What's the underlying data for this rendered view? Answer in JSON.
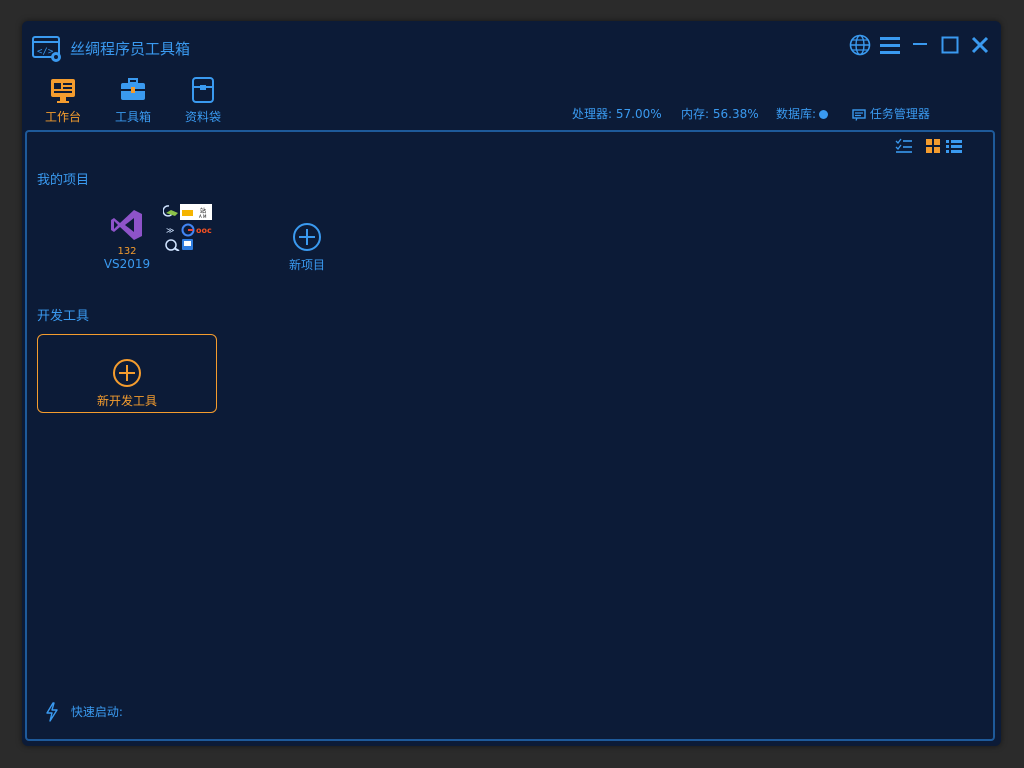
{
  "app": {
    "title": "丝绸程序员工具箱"
  },
  "nav": [
    {
      "label": "工作台",
      "icon": "dashboard-icon",
      "active": true
    },
    {
      "label": "工具箱",
      "icon": "toolbox-icon",
      "active": false
    },
    {
      "label": "资料袋",
      "icon": "bag-icon",
      "active": false
    }
  ],
  "status": {
    "cpu": "处理器: 57.00%",
    "memory": "内存: 56.38%",
    "database": "数据库:",
    "task_manager": "任务管理器"
  },
  "projects": {
    "section_title": "我的项目",
    "items": [
      {
        "label": "VS2019",
        "count": "132",
        "icon": "visual-studio-icon"
      }
    ],
    "new_label": "新项目"
  },
  "devtools": {
    "section_title": "开发工具",
    "new_label": "新开发工具"
  },
  "quick_launch": {
    "label": "快速启动:"
  },
  "colors": {
    "accent": "#3a9af0",
    "active": "#f49c2e",
    "background": "#0c1b37"
  }
}
